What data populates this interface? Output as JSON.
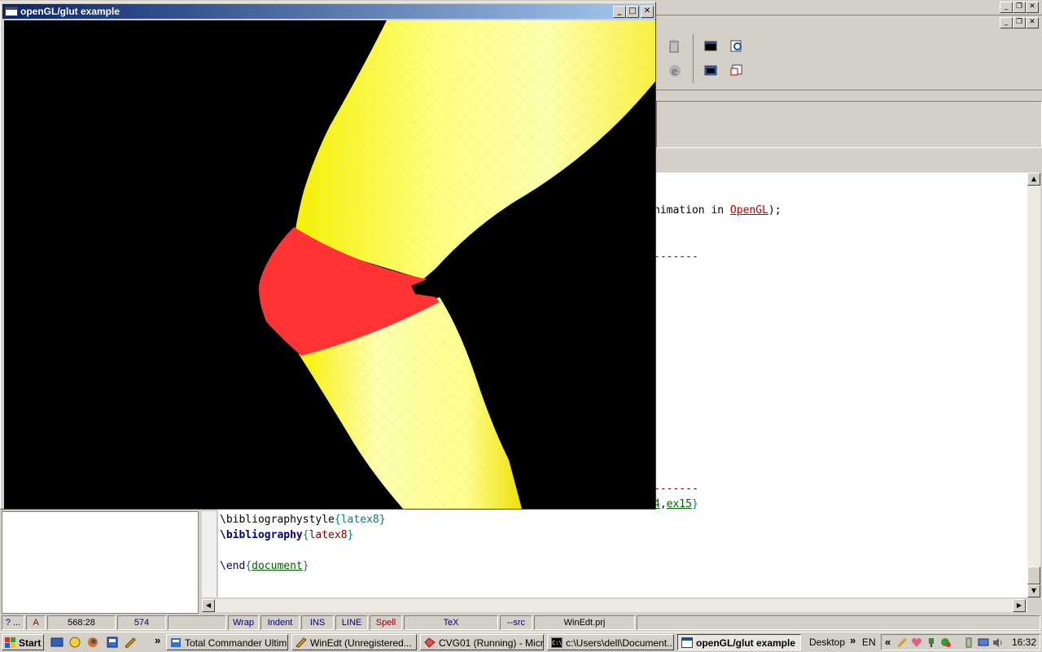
{
  "gl_window": {
    "title": "openGL/glut example",
    "minimize": "_",
    "maximize": "□",
    "close": "✕"
  },
  "editor": {
    "visible_fragments": {
      "line1_part1": "nimation in ",
      "line1_link": "OpenGL",
      "line1_end": ");",
      "dash1": "-------",
      "dash2": "-------",
      "tail_link": "4",
      "tail_text": ",",
      "tail_link2": "ex15",
      "tail_brace": "}"
    },
    "lines": {
      "bibstyle_cmd": "\\bibliographystyle",
      "bibstyle_arg": "latex8",
      "bib_cmd": "\\bibliography",
      "bib_arg": "latex8",
      "end_cmd": "\\end",
      "end_arg": "document"
    }
  },
  "status_bar": {
    "help": "? ...",
    "mode_a": "A",
    "position": "568:28",
    "lines": "574",
    "wrap": "Wrap",
    "indent": "Indent",
    "ins": "INS",
    "line": "LINE",
    "spell": "Spell",
    "tex": "TeX",
    "src": "--src",
    "project": "WinEdt.prj"
  },
  "taskbar": {
    "start": "Start",
    "quick_more": "»",
    "buttons": [
      "Total Commander Ultim...",
      "WinEdt  (Unregistered...",
      "CVG01 (Running) - Micr...",
      "c:\\Users\\dell\\Document...",
      "openGL/glut example"
    ],
    "desktop": "Desktop",
    "desktop_more": "»",
    "lang": "EN",
    "tray_more": "«",
    "clock": "16:32"
  },
  "colors": {
    "titlebar_start": "#0a246a",
    "titlebar_end": "#a6caf0",
    "tube_yellow": "#ffff60",
    "joint_red": "#ff3333",
    "canvas_bg": "#000000"
  }
}
